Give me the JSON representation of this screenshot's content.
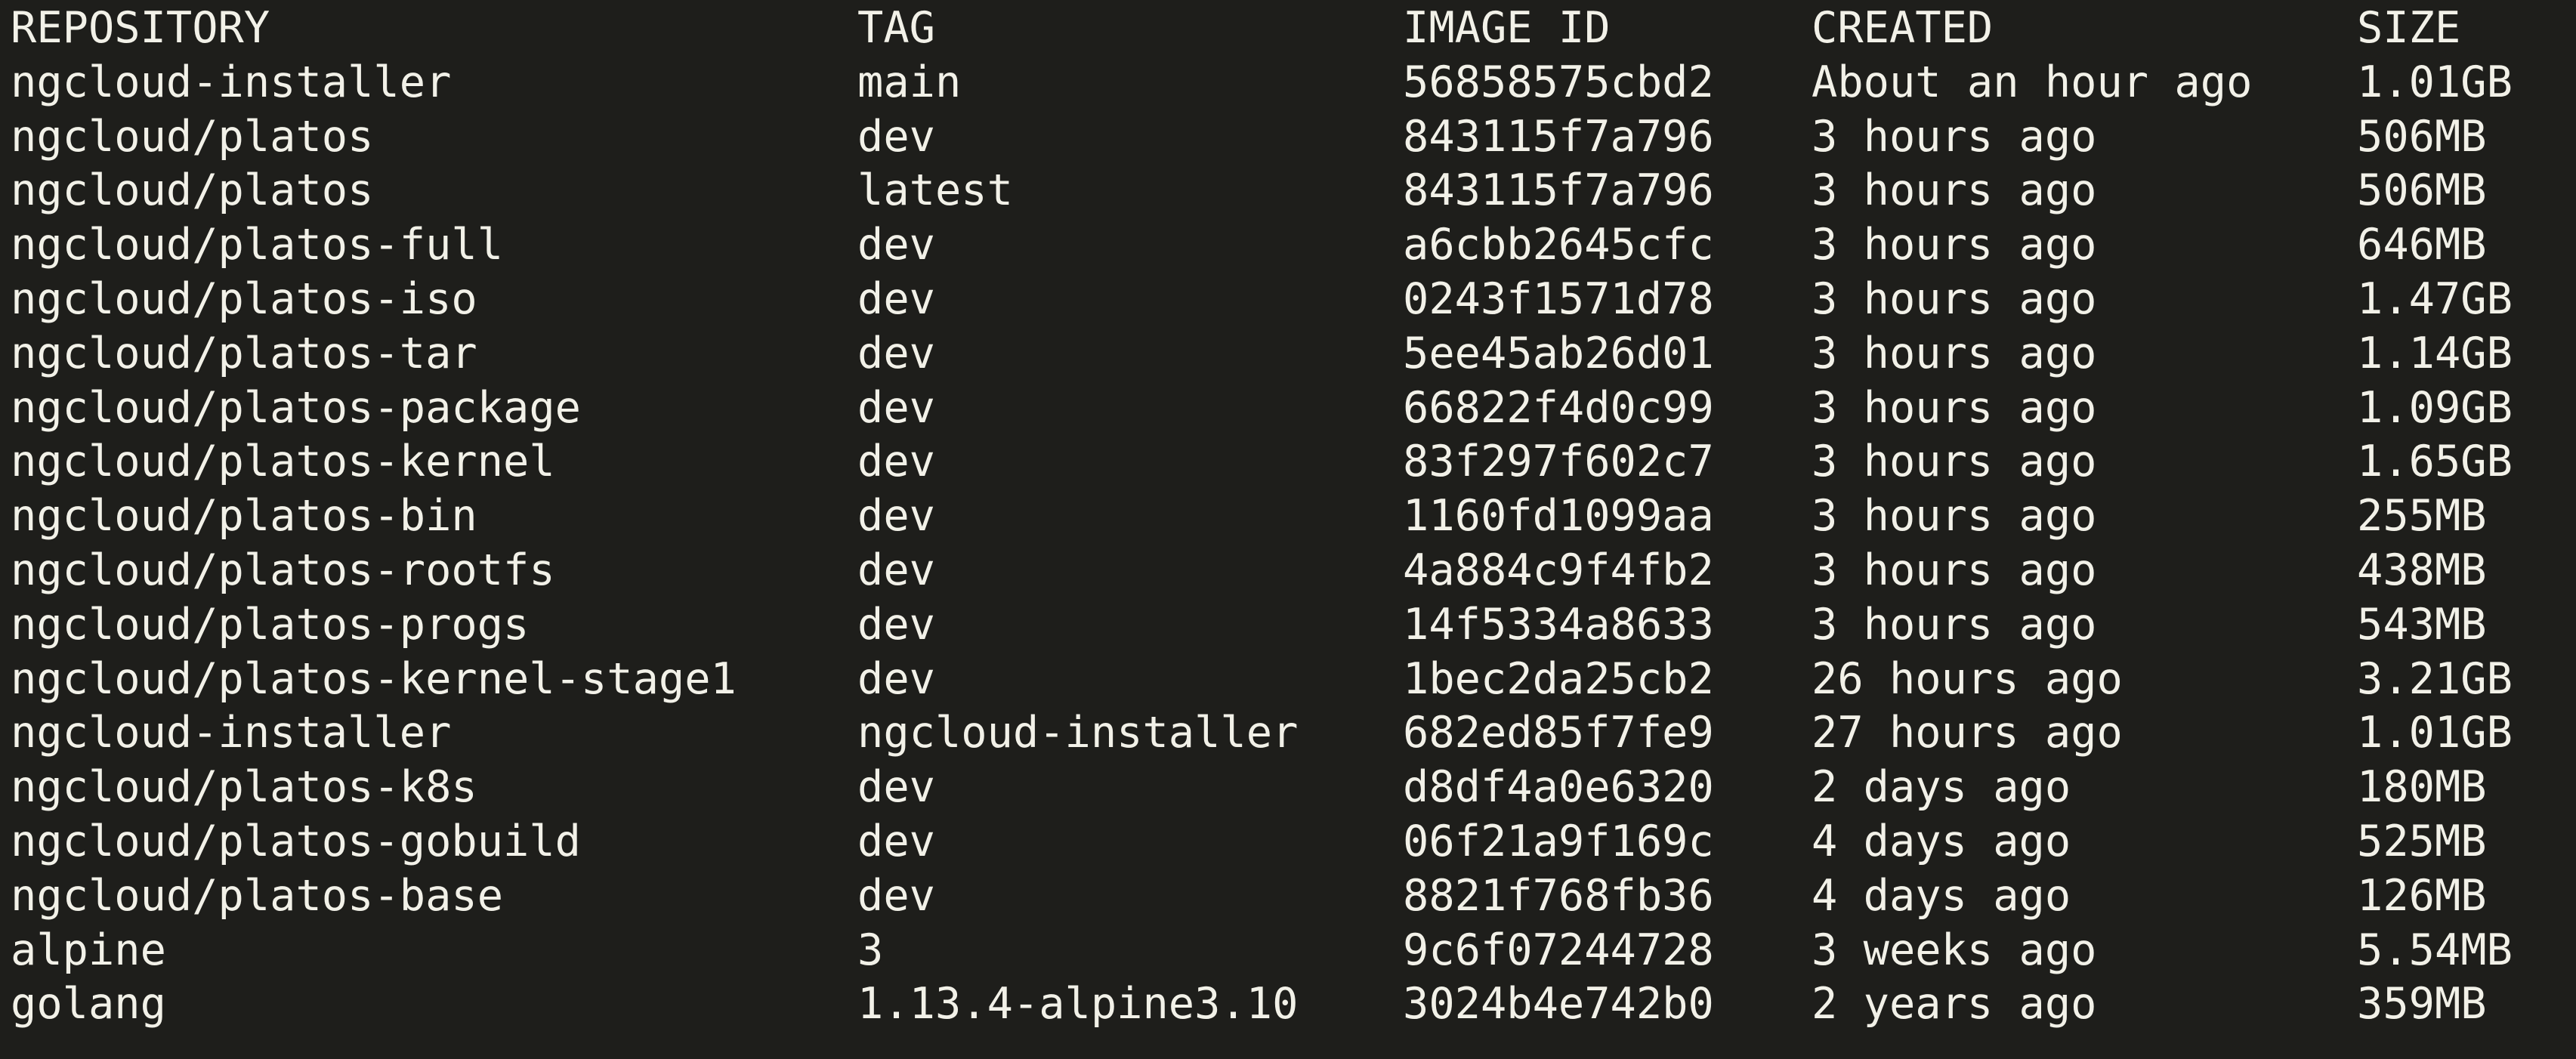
{
  "terminal": {
    "headers": [
      "REPOSITORY",
      "TAG",
      "IMAGE ID",
      "CREATED",
      "SIZE"
    ],
    "rows": [
      [
        "ngcloud-installer",
        "main",
        "56858575cbd2",
        "About an hour ago",
        "1.01GB"
      ],
      [
        "ngcloud/platos",
        "dev",
        "843115f7a796",
        "3 hours ago",
        "506MB"
      ],
      [
        "ngcloud/platos",
        "latest",
        "843115f7a796",
        "3 hours ago",
        "506MB"
      ],
      [
        "ngcloud/platos-full",
        "dev",
        "a6cbb2645cfc",
        "3 hours ago",
        "646MB"
      ],
      [
        "ngcloud/platos-iso",
        "dev",
        "0243f1571d78",
        "3 hours ago",
        "1.47GB"
      ],
      [
        "ngcloud/platos-tar",
        "dev",
        "5ee45ab26d01",
        "3 hours ago",
        "1.14GB"
      ],
      [
        "ngcloud/platos-package",
        "dev",
        "66822f4d0c99",
        "3 hours ago",
        "1.09GB"
      ],
      [
        "ngcloud/platos-kernel",
        "dev",
        "83f297f602c7",
        "3 hours ago",
        "1.65GB"
      ],
      [
        "ngcloud/platos-bin",
        "dev",
        "1160fd1099aa",
        "3 hours ago",
        "255MB"
      ],
      [
        "ngcloud/platos-rootfs",
        "dev",
        "4a884c9f4fb2",
        "3 hours ago",
        "438MB"
      ],
      [
        "ngcloud/platos-progs",
        "dev",
        "14f5334a8633",
        "3 hours ago",
        "543MB"
      ],
      [
        "ngcloud/platos-kernel-stage1",
        "dev",
        "1bec2da25cb2",
        "26 hours ago",
        "3.21GB"
      ],
      [
        "ngcloud-installer",
        "ngcloud-installer",
        "682ed85f7fe9",
        "27 hours ago",
        "1.01GB"
      ],
      [
        "ngcloud/platos-k8s",
        "dev",
        "d8df4a0e6320",
        "2 days ago",
        "180MB"
      ],
      [
        "ngcloud/platos-gobuild",
        "dev",
        "06f21a9f169c",
        "4 days ago",
        "525MB"
      ],
      [
        "ngcloud/platos-base",
        "dev",
        "8821f768fb36",
        "4 days ago",
        "126MB"
      ],
      [
        "alpine",
        "3",
        "9c6f07244728",
        "3 weeks ago",
        "5.54MB"
      ],
      [
        "golang",
        "1.13.4-alpine3.10",
        "3024b4e742b0",
        "2 years ago",
        "359MB"
      ]
    ]
  }
}
